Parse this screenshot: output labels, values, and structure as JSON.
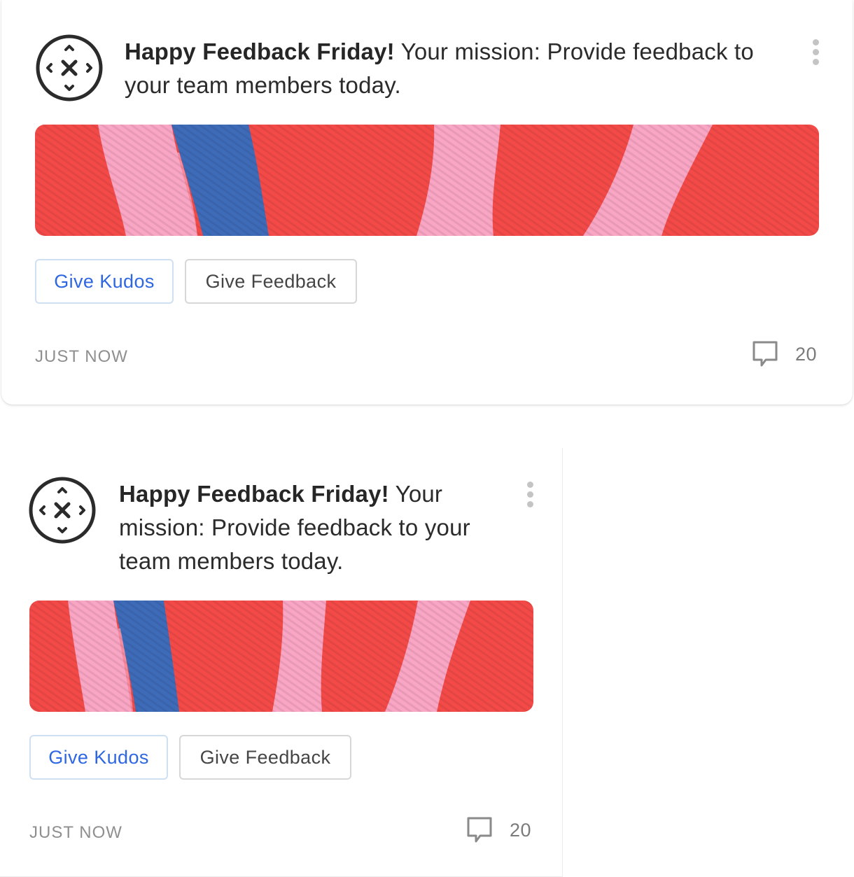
{
  "posts": [
    {
      "title_bold": "Happy Feedback Friday!",
      "title_rest": " Your mission: Provide feedback to your team members today.",
      "kudos_label": "Give Kudos",
      "feedback_label": "Give Feedback",
      "timestamp": "JUST NOW",
      "comment_count": "20",
      "avatar_icon": "compass-cross-icon",
      "menu_icon": "vertical-dots-icon",
      "comment_icon": "speech-bubble-icon"
    },
    {
      "title_bold": "Happy Feedback Friday!",
      "title_rest": " Your mission: Provide feedback to your team members today.",
      "kudos_label": "Give Kudos",
      "feedback_label": "Give Feedback",
      "timestamp": "JUST NOW",
      "comment_count": "20",
      "avatar_icon": "compass-cross-icon",
      "menu_icon": "vertical-dots-icon",
      "comment_icon": "speech-bubble-icon"
    }
  ],
  "colors": {
    "banner_red": "#f34a48",
    "banner_pink": "#f9a5c4",
    "banner_blue": "#3e6bb8",
    "kudos_text": "#2f67e2",
    "kudos_border": "#cfe0f3"
  }
}
